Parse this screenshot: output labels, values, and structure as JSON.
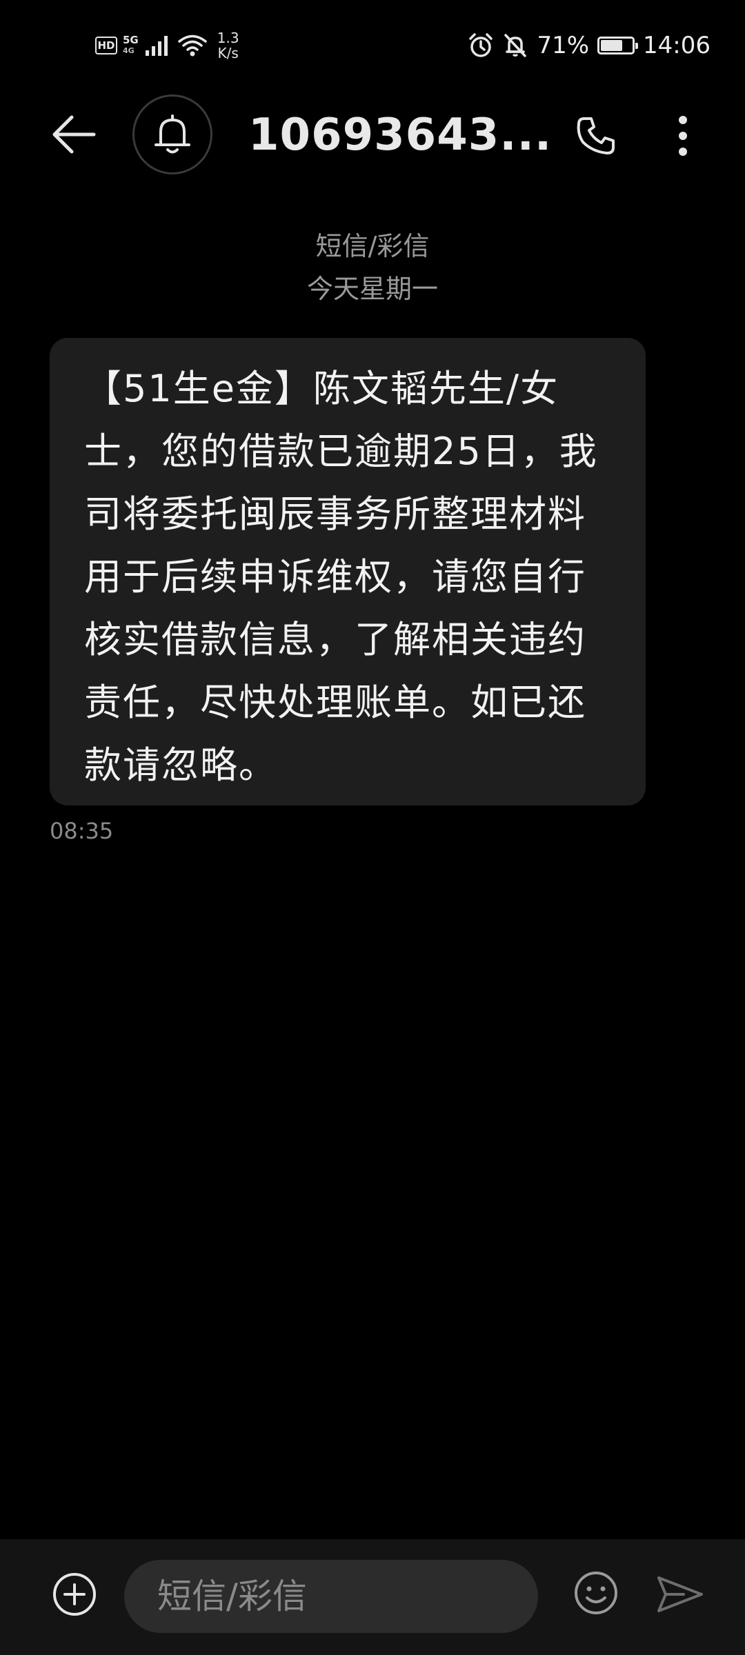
{
  "status_bar": {
    "hd": "HD",
    "network": "5G",
    "network_sub": "4G",
    "speed_value": "1.3",
    "speed_unit": "K/s",
    "battery_percent": "71%",
    "battery_level": 0.71,
    "time": "14:06"
  },
  "header": {
    "contact": "10693643..."
  },
  "conversation": {
    "channel_label": "短信/彩信",
    "date_label": "今天星期一",
    "message": {
      "text": "【51生e金】陈文韬先生/女士，您的借款已逾期25日，我司将委托闽辰事务所整理材料用于后续申诉维权，请您自行核实借款信息，了解相关违约责任，尽快处理账单。如已还款请忽略。",
      "time": "08:35"
    }
  },
  "composer": {
    "placeholder": "短信/彩信"
  },
  "icons": {
    "back": "back-arrow-icon",
    "avatar": "bell-icon",
    "call": "phone-icon",
    "more": "more-vertical-icon",
    "add": "plus-circle-icon",
    "emoji": "emoji-icon",
    "send": "send-icon",
    "alarm": "alarm-icon",
    "mute": "bell-off-icon"
  },
  "colors": {
    "background": "#000000",
    "bubble": "#1e1e1e",
    "secondary_text": "#9a9a9a",
    "composer_bg": "#141414",
    "input_bg": "#2c2c2c"
  }
}
